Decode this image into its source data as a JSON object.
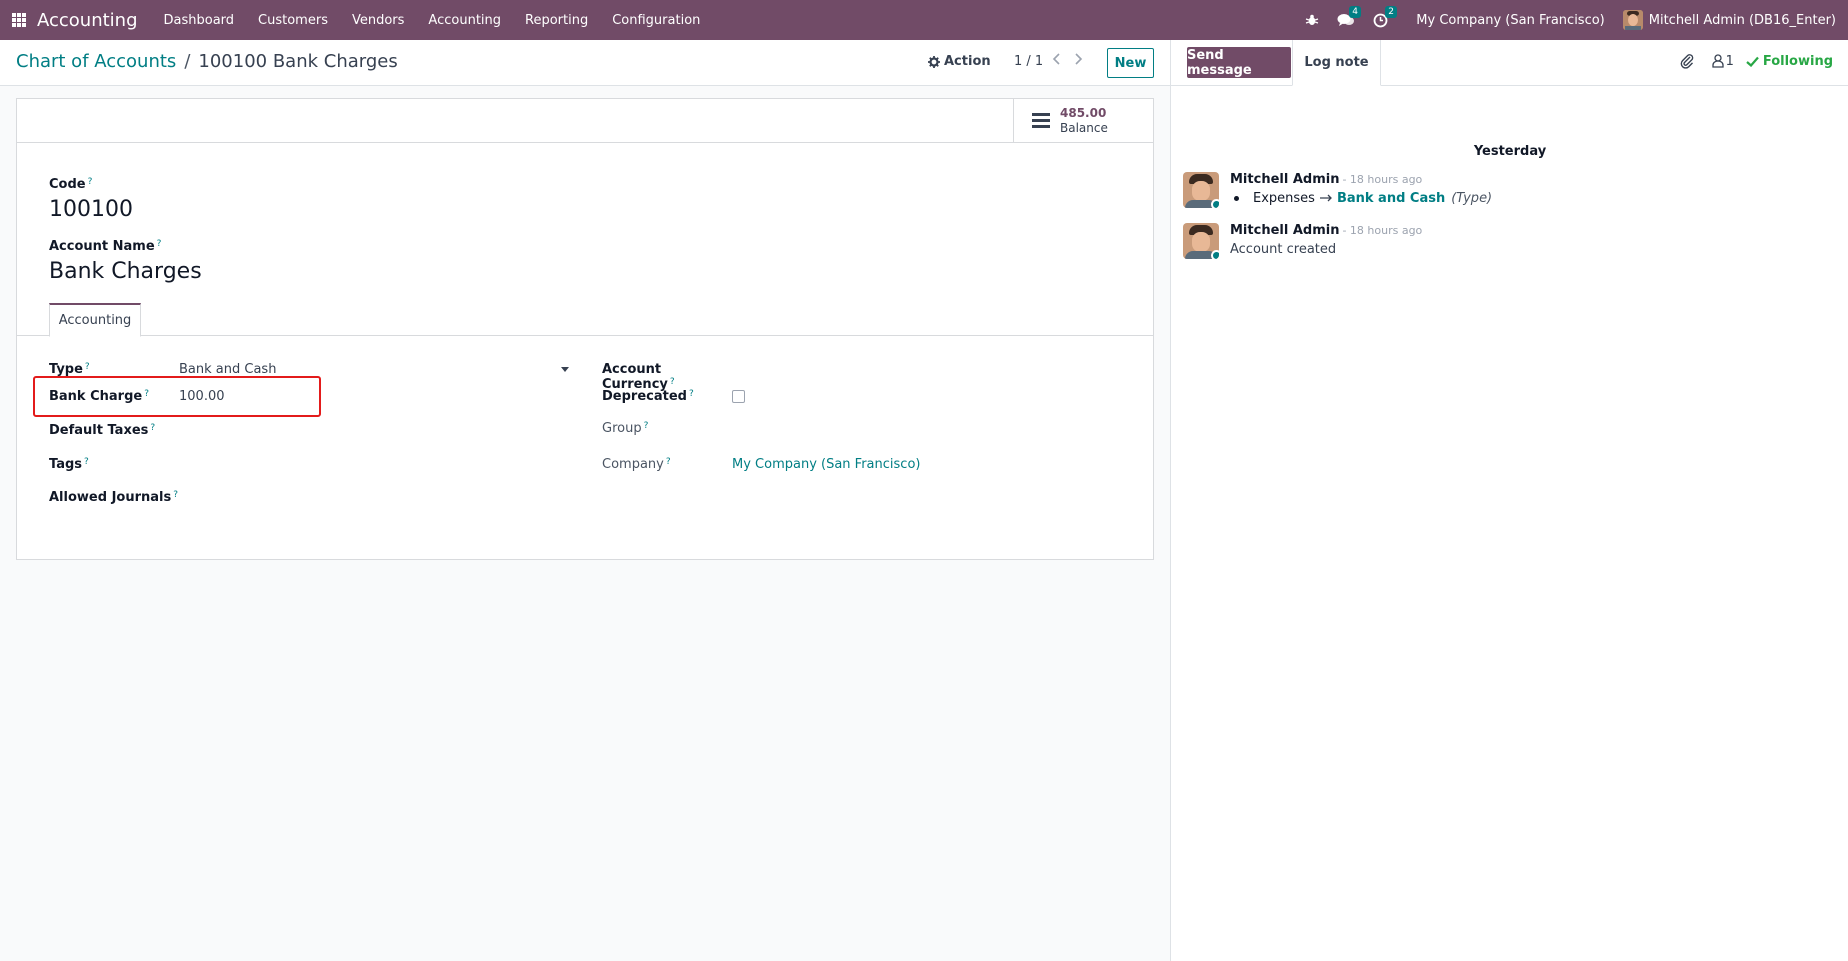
{
  "navbar": {
    "app_name": "Accounting",
    "menu": [
      "Dashboard",
      "Customers",
      "Vendors",
      "Accounting",
      "Reporting",
      "Configuration"
    ],
    "messages_badge": "4",
    "activities_badge": "2",
    "company": "My Company (San Francisco)",
    "user": "Mitchell Admin (DB16_Enter)"
  },
  "control_panel": {
    "breadcrumb_parent": "Chart of Accounts",
    "breadcrumb_separator": "/",
    "breadcrumb_current": "100100 Bank Charges",
    "action_label": "Action",
    "pager": "1 / 1",
    "new_label": "New"
  },
  "stat_button": {
    "value": "485.00",
    "label": "Balance"
  },
  "form": {
    "code_label": "Code",
    "code_value": "100100",
    "name_label": "Account Name",
    "name_value": "Bank Charges",
    "tab_label": "Accounting",
    "left_fields": {
      "type_label": "Type",
      "type_value": "Bank and Cash",
      "bank_charge_label": "Bank Charge",
      "bank_charge_value": "100.00",
      "default_taxes_label": "Default Taxes",
      "tags_label": "Tags",
      "allowed_journals_label": "Allowed Journals"
    },
    "right_fields": {
      "currency_label": "Account Currency",
      "deprecated_label": "Deprecated",
      "group_label": "Group",
      "company_label": "Company",
      "company_value": "My Company (San Francisco)"
    },
    "help_marker": "?"
  },
  "chatter": {
    "send_message_label": "Send message",
    "log_note_label": "Log note",
    "followers_count": "1",
    "following_label": "Following",
    "day_label": "Yesterday",
    "messages": [
      {
        "author": "Mitchell Admin",
        "time": "- 18 hours ago",
        "old_value": "Expenses",
        "new_value": "Bank and Cash",
        "field": "(Type)"
      },
      {
        "author": "Mitchell Admin",
        "time": "- 18 hours ago",
        "body": "Account created"
      }
    ]
  },
  "colors": {
    "brand": "#714b67",
    "accent": "#017e84",
    "highlight_border": "#e31b1b",
    "following": "#28a745"
  }
}
